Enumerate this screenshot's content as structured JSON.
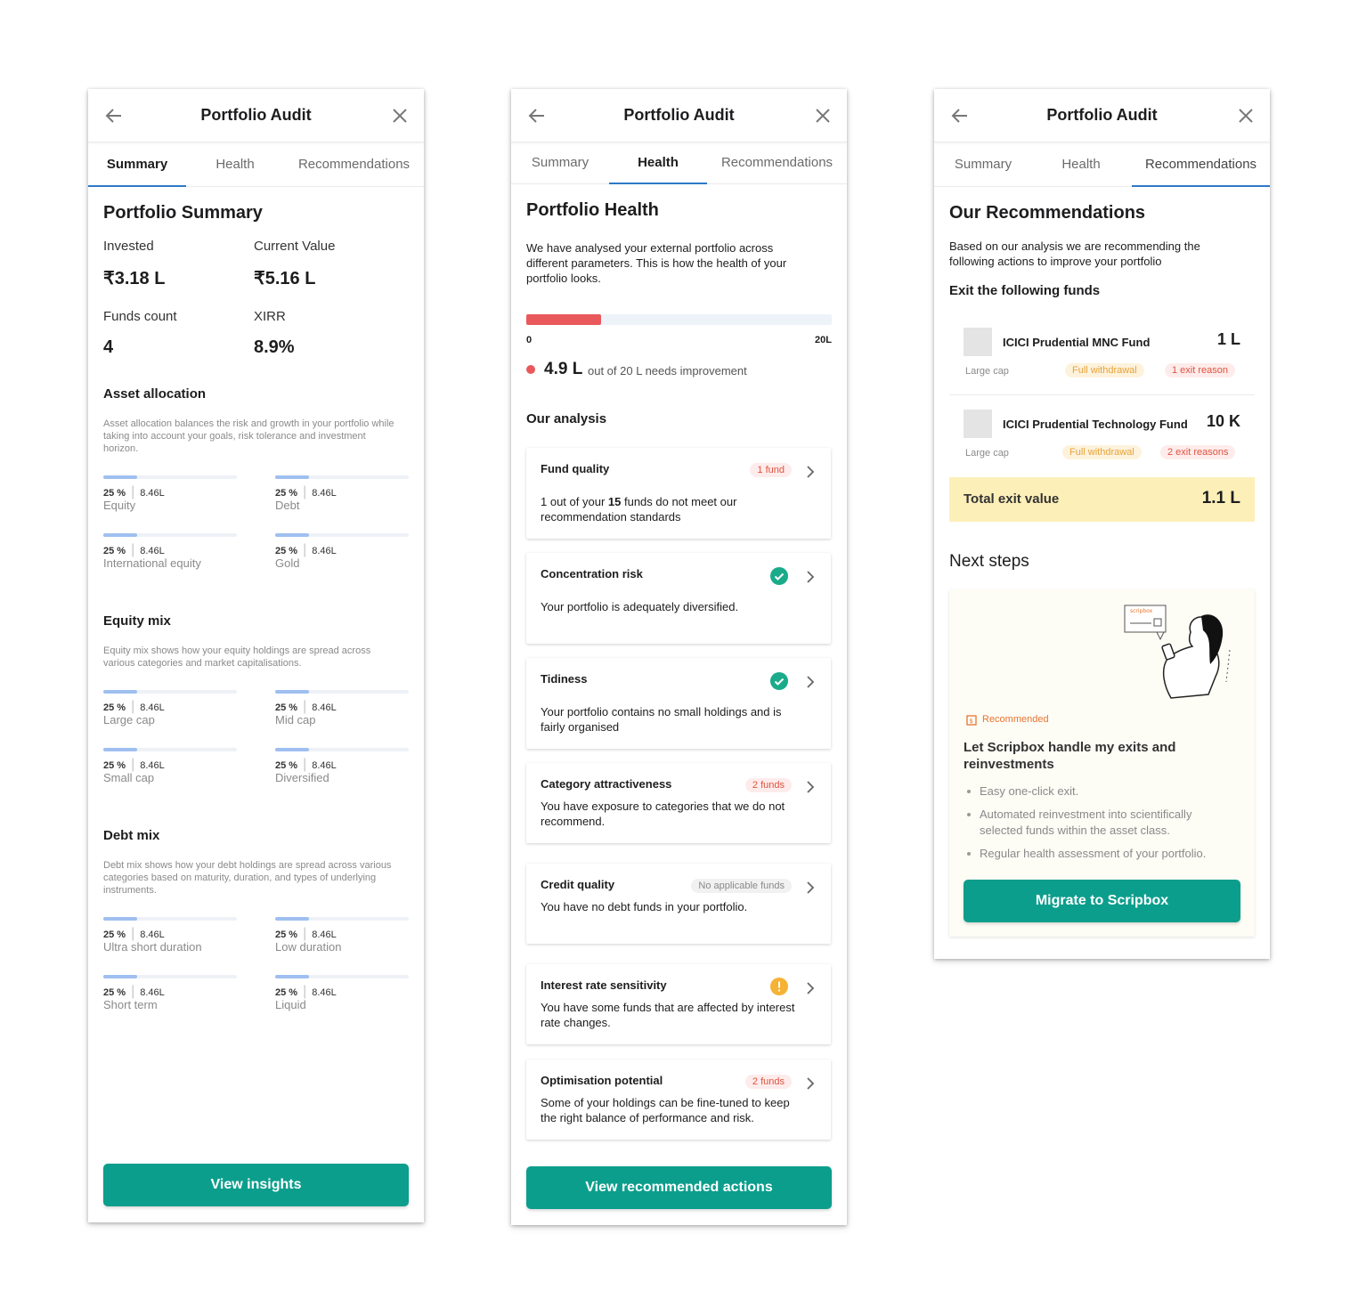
{
  "header": {
    "title": "Portfolio Audit"
  },
  "tabs": {
    "summary": "Summary",
    "health": "Health",
    "recommendations": "Recommendations"
  },
  "summary": {
    "title": "Portfolio Summary",
    "invested_label": "Invested",
    "invested_value": "₹3.18 L",
    "current_label": "Current Value",
    "current_value": "₹5.16 L",
    "funds_label": "Funds count",
    "funds_value": "4",
    "xirr_label": "XIRR",
    "xirr_value": "8.9%",
    "asset": {
      "title": "Asset allocation",
      "desc": "Asset allocation balances the risk and growth in your portfolio while taking into account your goals, risk tolerance and investment horizon.",
      "items": [
        {
          "pct": "25 %",
          "amt": "8.46L",
          "name": "Equity",
          "fraction": 0.25
        },
        {
          "pct": "25 %",
          "amt": "8.46L",
          "name": "Debt",
          "fraction": 0.25
        },
        {
          "pct": "25 %",
          "amt": "8.46L",
          "name": "International equity",
          "fraction": 0.25
        },
        {
          "pct": "25 %",
          "amt": "8.46L",
          "name": "Gold",
          "fraction": 0.25
        }
      ]
    },
    "equity": {
      "title": "Equity mix",
      "desc": "Equity mix shows how your equity holdings are spread across various categories and market capitalisations.",
      "items": [
        {
          "pct": "25 %",
          "amt": "8.46L",
          "name": "Large cap",
          "fraction": 0.25
        },
        {
          "pct": "25 %",
          "amt": "8.46L",
          "name": "Mid cap",
          "fraction": 0.25
        },
        {
          "pct": "25 %",
          "amt": "8.46L",
          "name": "Small cap",
          "fraction": 0.25
        },
        {
          "pct": "25 %",
          "amt": "8.46L",
          "name": "Diversified",
          "fraction": 0.25
        }
      ]
    },
    "debt": {
      "title": "Debt mix",
      "desc": "Debt mix shows how your debt holdings are spread across various categories based on maturity, duration, and types of underlying instruments.",
      "items": [
        {
          "pct": "25 %",
          "amt": "8.46L",
          "name": "Ultra short duration",
          "fraction": 0.25
        },
        {
          "pct": "25 %",
          "amt": "8.46L",
          "name": "Low duration",
          "fraction": 0.25
        },
        {
          "pct": "25 %",
          "amt": "8.46L",
          "name": "Short term",
          "fraction": 0.25
        },
        {
          "pct": "25 %",
          "amt": "8.46L",
          "name": "Liquid",
          "fraction": 0.25
        }
      ]
    },
    "button": "View insights"
  },
  "health": {
    "title": "Portfolio Health",
    "intro": "We have analysed your external portfolio across different parameters. This is how the health of your portfolio looks.",
    "progress": {
      "min": "0",
      "max": "20L",
      "fraction": 0.245
    },
    "value": "4.9 L",
    "value_text": "out of 20 L needs improvement",
    "analysis_title": "Our analysis",
    "cards": [
      {
        "title": "Fund quality",
        "badge": "1 fund",
        "desc_pre": "1 out of your ",
        "desc_bold": "15",
        "desc_post": " funds do not meet our recommendation standards"
      },
      {
        "title": "Concentration risk",
        "status": "check-icon",
        "desc": "Your portfolio is adequately diversified."
      },
      {
        "title": "Tidiness",
        "status": "check-icon",
        "desc": "Your portfolio contains no small holdings and is fairly organised"
      },
      {
        "title": "Category attractiveness",
        "badge": "2 funds",
        "desc": "You have exposure to categories that we do not recommend."
      },
      {
        "title": "Credit quality",
        "badge": "No applicable funds",
        "desc": "You have no debt funds in your portfolio."
      },
      {
        "title": "Interest rate sensitivity",
        "status": "warning-icon",
        "desc": "You have some funds that are affected by interest rate changes."
      },
      {
        "title": "Optimisation potential",
        "badge": "2 funds",
        "desc": "Some of your holdings can be fine-tuned to keep the right balance of performance and risk."
      }
    ],
    "button": "View recommended actions"
  },
  "recommendations": {
    "title": "Our Recommendations",
    "intro": "Based on our analysis we are recommending the following actions  to improve your portfolio",
    "exit_title": "Exit the following funds",
    "funds": [
      {
        "name": "ICICI Prudential MNC Fund",
        "value": "1 L",
        "category": "Large cap",
        "action": "Full withdrawal",
        "reason": "1 exit reason"
      },
      {
        "name": "ICICI Prudential Technology Fund",
        "value": "10 K",
        "category": "Large cap",
        "action": "Full withdrawal",
        "reason": "2 exit reasons"
      }
    ],
    "total_label": "Total exit value",
    "total_value": "1.1 L",
    "next_title": "Next steps",
    "brand_tag": "scripbox",
    "recommended_label": "Recommended",
    "offer_title": "Let Scripbox handle my exits and reinvestments",
    "bullets": [
      "Easy one-click exit.",
      "Automated reinvestment into scientifically selected funds within the asset class.",
      "Regular health assessment of your portfolio."
    ],
    "button": "Migrate to Scripbox"
  },
  "colors": {
    "accent": "#0c9e8c",
    "tab_underline": "#2d79c7",
    "health_bar": "#e9595c",
    "total_bg": "#fdefb8"
  }
}
